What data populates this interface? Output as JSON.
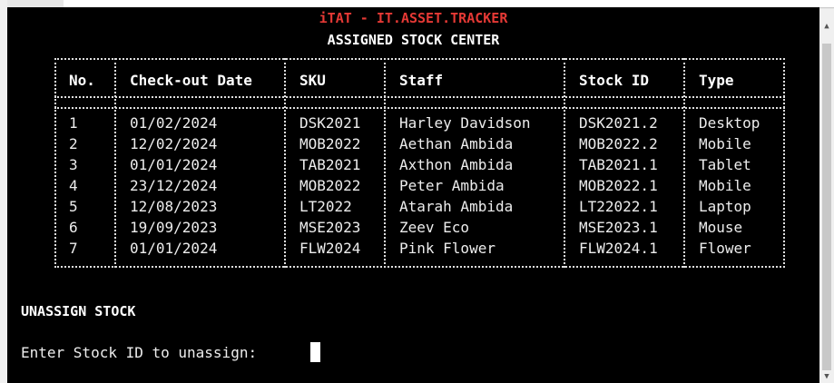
{
  "app": {
    "title": "iTAT - IT.ASSET.TRACKER",
    "subtitle": "ASSIGNED STOCK CENTER"
  },
  "table": {
    "headers": [
      "No.",
      "Check-out Date",
      "SKU",
      "Staff",
      "Stock ID",
      "Type"
    ],
    "rows": [
      [
        "1",
        "01/02/2024",
        "DSK2021",
        "Harley Davidson",
        "DSK2021.2",
        "Desktop"
      ],
      [
        "2",
        "12/02/2024",
        "MOB2022",
        "Aethan Ambida",
        "MOB2022.2",
        "Mobile"
      ],
      [
        "3",
        "01/01/2024",
        "TAB2021",
        "Axthon Ambida",
        "TAB2021.1",
        "Tablet"
      ],
      [
        "4",
        "23/12/2024",
        "MOB2022",
        "Peter Ambida",
        "MOB2022.1",
        "Mobile"
      ],
      [
        "5",
        "12/08/2023",
        "LT2022",
        "Atarah Ambida",
        "LT22022.1",
        "Laptop"
      ],
      [
        "6",
        "19/09/2023",
        "MSE2023",
        "Zeev Eco",
        "MSE2023.1",
        "Mouse"
      ],
      [
        "7",
        "01/01/2024",
        "FLW2024",
        "Pink Flower",
        "FLW2024.1",
        "Flower"
      ]
    ]
  },
  "unassign": {
    "title": "UNASSIGN STOCK",
    "prompt": "Enter Stock ID to unassign:",
    "input_value": ""
  },
  "scrollbar": {
    "up": "▲",
    "down": "▼"
  },
  "colors": {
    "title": "#e53935",
    "background": "#000000",
    "text": "#ededed"
  }
}
